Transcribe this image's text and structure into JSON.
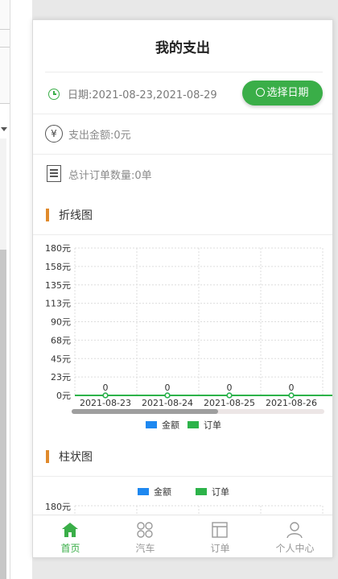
{
  "header": {
    "title": "我的支出"
  },
  "date_filter": {
    "label": "日期:2021-08-23,2021-08-29",
    "button_label": "选择日期",
    "accent": "#3aae48"
  },
  "summary": {
    "amount_label": "支出金额:0元",
    "order_label": "总计订单数量:0单"
  },
  "sections": {
    "line_title": "折线图",
    "bar_title": "柱状图"
  },
  "chart_data": [
    {
      "type": "line",
      "title": "折线图",
      "categories": [
        "2021-08-23",
        "2021-08-24",
        "2021-08-25",
        "2021-08-26"
      ],
      "y_ticks": [
        "180元",
        "158元",
        "135元",
        "113元",
        "90元",
        "68元",
        "45元",
        "23元",
        "0元"
      ],
      "ylim": [
        0,
        180
      ],
      "series": [
        {
          "name": "金额",
          "color": "#1e88f0",
          "values": [
            0,
            0,
            0,
            0
          ]
        },
        {
          "name": "订单",
          "color": "#2db34a",
          "values": [
            0,
            0,
            0,
            0
          ]
        }
      ],
      "data_labels": [
        "0",
        "0",
        "0",
        "0"
      ],
      "grid": true,
      "legend_position": "bottom"
    },
    {
      "type": "bar",
      "title": "柱状图",
      "series": [
        {
          "name": "金额",
          "color": "#1e88f0"
        },
        {
          "name": "订单",
          "color": "#2db34a"
        }
      ],
      "y_ticks": [
        "180元"
      ],
      "legend_position": "top"
    }
  ],
  "tabbar": {
    "items": [
      {
        "label": "首页",
        "icon": "home-icon",
        "active": true
      },
      {
        "label": "汽车",
        "icon": "car-grid-icon",
        "active": false
      },
      {
        "label": "订单",
        "icon": "order-icon",
        "active": false
      },
      {
        "label": "个人中心",
        "icon": "user-icon",
        "active": false
      }
    ]
  }
}
